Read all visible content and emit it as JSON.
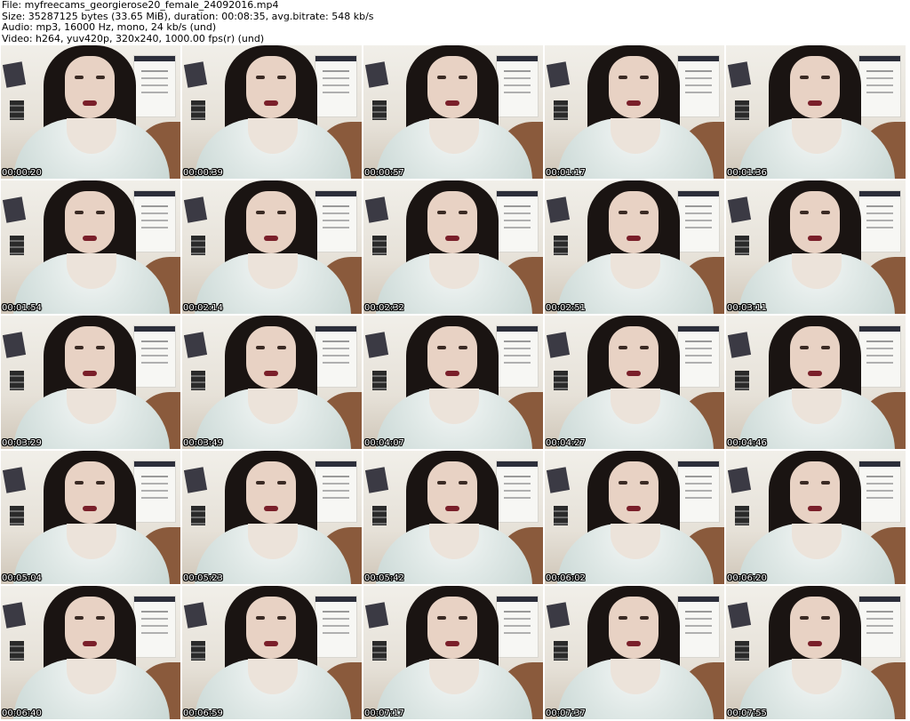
{
  "header": {
    "lines": [
      "File: myfreecams_georgierose20_female_24092016.mp4",
      "Size: 35287125 bytes (33.65 MiB), duration: 00:08:35, avg.bitrate: 548 kb/s",
      "Audio: mp3, 16000 Hz, mono, 24 kb/s (und)",
      "Video: h264, yuv420p, 320x240, 1000.00 fps(r) (und)"
    ]
  },
  "thumbnails": [
    {
      "time": "00:00:20"
    },
    {
      "time": "00:00:39"
    },
    {
      "time": "00:00:57"
    },
    {
      "time": "00:01:17"
    },
    {
      "time": "00:01:36"
    },
    {
      "time": "00:01:54"
    },
    {
      "time": "00:02:14"
    },
    {
      "time": "00:02:32"
    },
    {
      "time": "00:02:51"
    },
    {
      "time": "00:03:11"
    },
    {
      "time": "00:03:29"
    },
    {
      "time": "00:03:49"
    },
    {
      "time": "00:04:07"
    },
    {
      "time": "00:04:27"
    },
    {
      "time": "00:04:46"
    },
    {
      "time": "00:05:04"
    },
    {
      "time": "00:05:23"
    },
    {
      "time": "00:05:42"
    },
    {
      "time": "00:06:02"
    },
    {
      "time": "00:06:20"
    },
    {
      "time": "00:06:40"
    },
    {
      "time": "00:06:59"
    },
    {
      "time": "00:07:17"
    },
    {
      "time": "00:07:37"
    },
    {
      "time": "00:07:55"
    }
  ],
  "colors": {
    "background": "#ffffff",
    "header_text": "#000000",
    "timestamp_text": "#ffffff",
    "timestamp_outline": "#000000"
  }
}
